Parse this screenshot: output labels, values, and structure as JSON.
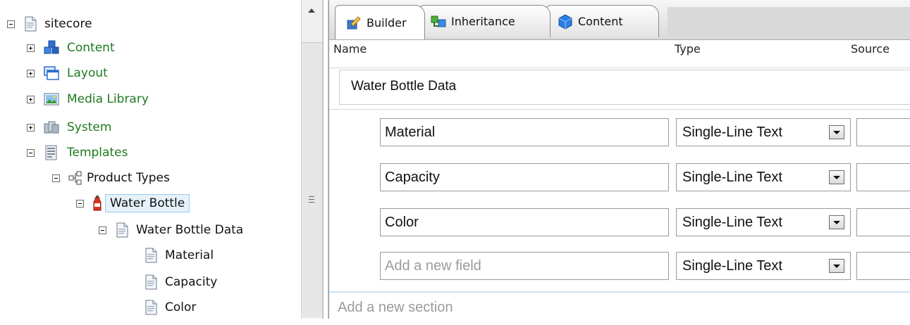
{
  "tree": {
    "root": {
      "label": "sitecore",
      "expanded": true
    },
    "items": [
      {
        "label": "Content",
        "state": "collapsed"
      },
      {
        "label": "Layout",
        "state": "collapsed"
      },
      {
        "label": "Media Library",
        "state": "collapsed"
      },
      {
        "label": "System",
        "state": "collapsed"
      },
      {
        "label": "Templates",
        "state": "expanded"
      }
    ],
    "product_types": {
      "label": "Product Types"
    },
    "water_bottle": {
      "label": "Water Bottle",
      "selected": true
    },
    "water_bottle_data": {
      "label": "Water Bottle Data"
    },
    "fields": [
      {
        "label": "Material"
      },
      {
        "label": "Capacity"
      },
      {
        "label": "Color"
      }
    ]
  },
  "tabs": [
    {
      "label": "Builder",
      "active": true
    },
    {
      "label": "Inheritance",
      "active": false
    },
    {
      "label": "Content",
      "active": false
    }
  ],
  "builder": {
    "columns": {
      "name": "Name",
      "type": "Type",
      "source": "Source"
    },
    "section_name": "Water Bottle Data",
    "fields": [
      {
        "name": "Material",
        "type": "Single-Line Text"
      },
      {
        "name": "Capacity",
        "type": "Single-Line Text"
      },
      {
        "name": "Color",
        "type": "Single-Line Text"
      }
    ],
    "new_field": {
      "placeholder": "Add a new field",
      "type": "Single-Line Text"
    },
    "new_section": {
      "placeholder": "Add a new section"
    }
  },
  "colors": {
    "tree_green": "#1e7a1e",
    "selection_bg": "#e6f2fb",
    "selection_border": "#9ccbef"
  }
}
